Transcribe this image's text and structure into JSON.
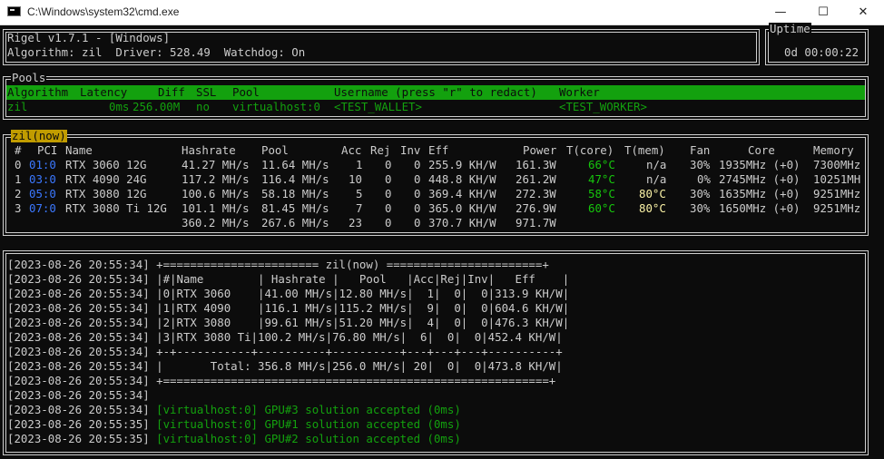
{
  "window": {
    "title": "C:\\Windows\\system32\\cmd.exe",
    "minimize_glyph": "—",
    "maximize_glyph": "☐",
    "close_glyph": "✕"
  },
  "header": {
    "line1": "Rigel v1.7.1 - [Windows]",
    "line2": "Algorithm: zil  Driver: 528.49  Watchdog: On"
  },
  "uptime": {
    "label": "Uptime",
    "value": "0d 00:00:22"
  },
  "pools": {
    "label": "Pools",
    "columns": [
      "Algorithm",
      "Latency",
      "Diff",
      "SSL",
      "Pool",
      "Username (press \"r\" to redact)",
      "Worker"
    ],
    "row": {
      "algorithm": "zil",
      "latency": "0ms",
      "diff": "256.00M",
      "ssl": "no",
      "pool": "virtualhost:0",
      "username": "<TEST_WALLET>",
      "worker": "<TEST_WORKER>"
    }
  },
  "gpus": {
    "label": "zil(now)",
    "columns": [
      "#",
      "PCI",
      "Name",
      "Hashrate",
      "Pool",
      "Acc",
      "Rej",
      "Inv",
      "Eff",
      "Power",
      "T(core)",
      "T(mem)",
      "Fan",
      "Core",
      "Memory"
    ],
    "rows": [
      {
        "idx": "0",
        "pci": "01:0",
        "name": "RTX 3060 12G",
        "hashrate": "41.27 MH/s",
        "pool": "11.64 MH/s",
        "acc": "1",
        "rej": "0",
        "inv": "0",
        "eff": "255.9 KH/W",
        "power": "161.3W",
        "tcore": "66°C",
        "tmem": "n/a",
        "fan": "30%",
        "core": "1935MHz (+0)",
        "memory": "7300MHz"
      },
      {
        "idx": "1",
        "pci": "03:0",
        "name": "RTX 4090 24G",
        "hashrate": "117.2 MH/s",
        "pool": "116.4 MH/s",
        "acc": "10",
        "rej": "0",
        "inv": "0",
        "eff": "448.8 KH/W",
        "power": "261.2W",
        "tcore": "47°C",
        "tmem": "n/a",
        "fan": "0%",
        "core": "2745MHz (+0)",
        "memory": "10251MH"
      },
      {
        "idx": "2",
        "pci": "05:0",
        "name": "RTX 3080 12G",
        "hashrate": "100.6 MH/s",
        "pool": "58.18 MH/s",
        "acc": "5",
        "rej": "0",
        "inv": "0",
        "eff": "369.4 KH/W",
        "power": "272.3W",
        "tcore": "58°C",
        "tmem": "80°C",
        "fan": "30%",
        "core": "1635MHz (+0)",
        "memory": "9251MHz"
      },
      {
        "idx": "3",
        "pci": "07:0",
        "name": "RTX 3080 Ti 12G",
        "hashrate": "101.1 MH/s",
        "pool": "81.45 MH/s",
        "acc": "7",
        "rej": "0",
        "inv": "0",
        "eff": "365.0 KH/W",
        "power": "276.9W",
        "tcore": "60°C",
        "tmem": "80°C",
        "fan": "30%",
        "core": "1650MHz (+0)",
        "memory": "9251MHz"
      }
    ],
    "total": {
      "hashrate": "360.2 MH/s",
      "pool": "267.6 MH/s",
      "acc": "23",
      "rej": "0",
      "inv": "0",
      "eff": "370.7 KH/W",
      "power": "971.7W"
    }
  },
  "log": [
    {
      "ts": "[2023-08-26 20:55:34]",
      "text": " +======================= zil(now) =======================+",
      "color": "normal"
    },
    {
      "ts": "[2023-08-26 20:55:34]",
      "text": " |#|Name        | Hashrate |   Pool   |Acc|Rej|Inv|   Eff    |",
      "color": "normal"
    },
    {
      "ts": "[2023-08-26 20:55:34]",
      "text": " |0|RTX 3060    |41.00 MH/s|12.80 MH/s|  1|  0|  0|313.9 KH/W|",
      "color": "normal"
    },
    {
      "ts": "[2023-08-26 20:55:34]",
      "text": " |1|RTX 4090    |116.1 MH/s|115.2 MH/s|  9|  0|  0|604.6 KH/W|",
      "color": "normal"
    },
    {
      "ts": "[2023-08-26 20:55:34]",
      "text": " |2|RTX 3080    |99.61 MH/s|51.20 MH/s|  4|  0|  0|476.3 KH/W|",
      "color": "normal"
    },
    {
      "ts": "[2023-08-26 20:55:34]",
      "text": " |3|RTX 3080 Ti|100.2 MH/s|76.80 MH/s|  6|  0|  0|452.4 KH/W|",
      "color": "normal"
    },
    {
      "ts": "[2023-08-26 20:55:34]",
      "text": " +-+-----------+----------+----------+---+---+---+----------+",
      "color": "normal"
    },
    {
      "ts": "[2023-08-26 20:55:34]",
      "text": " |       Total: 356.8 MH/s|256.0 MH/s| 20|  0|  0|473.8 KH/W|",
      "color": "normal"
    },
    {
      "ts": "[2023-08-26 20:55:34]",
      "text": " +=========================================================+",
      "color": "normal"
    },
    {
      "ts": "[2023-08-26 20:55:34]",
      "text": "",
      "color": "normal"
    },
    {
      "ts": "[2023-08-26 20:55:34]",
      "text": " [virtualhost:0] GPU#3 solution accepted (0ms)",
      "color": "green"
    },
    {
      "ts": "[2023-08-26 20:55:35]",
      "text": " [virtualhost:0] GPU#1 solution accepted (0ms)",
      "color": "green"
    },
    {
      "ts": "[2023-08-26 20:55:35]",
      "text": " [virtualhost:0] GPU#2 solution accepted (0ms)",
      "color": "green"
    }
  ]
}
